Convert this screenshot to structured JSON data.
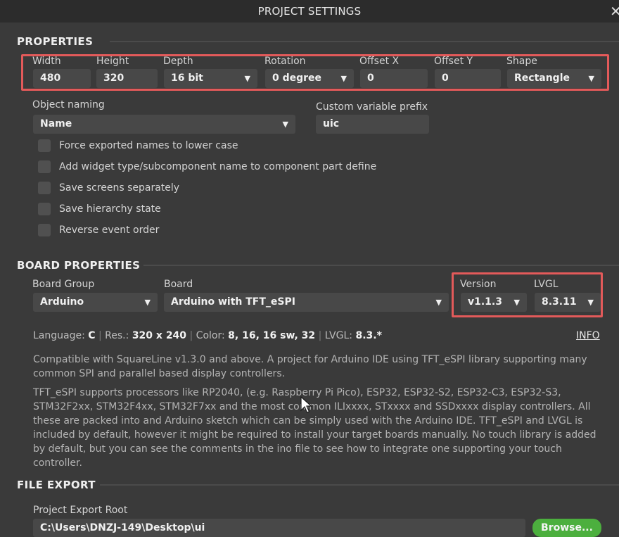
{
  "window": {
    "title": "PROJECT SETTINGS",
    "close_glyph": "✕"
  },
  "properties": {
    "title": "PROPERTIES",
    "width": {
      "label": "Width",
      "value": "480"
    },
    "height": {
      "label": "Height",
      "value": "320"
    },
    "depth": {
      "label": "Depth",
      "value": "16 bit"
    },
    "rotation": {
      "label": "Rotation",
      "value": "0 degree"
    },
    "offset_x": {
      "label": "Offset X",
      "value": "0"
    },
    "offset_y": {
      "label": "Offset Y",
      "value": "0"
    },
    "shape": {
      "label": "Shape",
      "value": "Rectangle"
    },
    "object_naming": {
      "label": "Object naming",
      "value": "Name"
    },
    "custom_prefix": {
      "label": "Custom variable prefix",
      "value": "uic"
    },
    "checkboxes": [
      {
        "label": "Force exported names to lower case",
        "checked": false
      },
      {
        "label": "Add widget type/subcomponent name to component part define",
        "checked": false
      },
      {
        "label": "Save screens separately",
        "checked": false
      },
      {
        "label": "Save hierarchy state",
        "checked": false
      },
      {
        "label": "Reverse event order",
        "checked": false
      }
    ]
  },
  "board": {
    "title": "BOARD PROPERTIES",
    "board_group": {
      "label": "Board Group",
      "value": "Arduino"
    },
    "board": {
      "label": "Board",
      "value": "Arduino with TFT_eSPI"
    },
    "version": {
      "label": "Version",
      "value": "v1.1.3"
    },
    "lvgl": {
      "label": "LVGL",
      "value": "8.3.11"
    },
    "info": {
      "language_label": "Language:",
      "language": "C",
      "res_label": "Res.:",
      "res": "320 x 240",
      "color_label": "Color:",
      "color": "8, 16, 16 sw, 32",
      "lvgl_label": "LVGL:",
      "lvgl": "8.3.*",
      "sep": "|"
    },
    "info_link": "INFO",
    "description_1": "Compatible with SquareLine v1.3.0 and above. A project for Arduino IDE using TFT_eSPI library supporting many common SPI and parallel based display controllers.",
    "description_2": "TFT_eSPI supports processors like RP2040, (e.g. Raspberry Pi Pico), ESP32, ESP32-S2, ESP32-C3, ESP32-S3, STM32F2xx, STM32F4xx, STM32F7xx and the most common ILIxxxx, STxxxx and SSDxxxx display controllers. All these are packed into and Arduino sketch which can be simply used with the Arduino IDE. TFT_eSPI and LVGL is included by default, however it might be required to install your target boards manually.  No touch library is added by default, but you can see the comments in the ino file to see how to integrate one supporting your touch controller."
  },
  "file_export": {
    "title": "FILE EXPORT",
    "root_label": "Project Export Root",
    "root_value": "C:\\Users\\DNZJ-149\\Desktop\\ui",
    "browse_label": "Browse..."
  },
  "icons": {
    "dropdown": "▼",
    "cursor": "mouse-pointer-icon"
  },
  "colors": {
    "highlight": "#e35a5a",
    "browse": "#4caf3e",
    "background": "#3a3a3a"
  }
}
